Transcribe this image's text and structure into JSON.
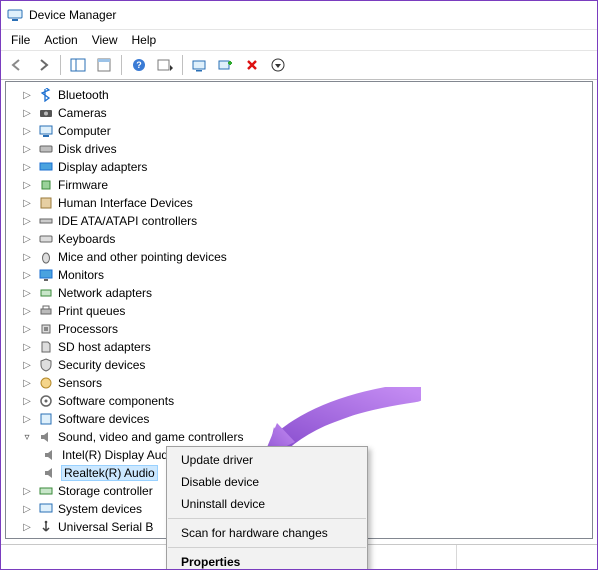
{
  "window": {
    "title": "Device Manager"
  },
  "menu": {
    "file": "File",
    "action": "Action",
    "view": "View",
    "help": "Help"
  },
  "tree": {
    "items": [
      {
        "label": "Bluetooth"
      },
      {
        "label": "Cameras"
      },
      {
        "label": "Computer"
      },
      {
        "label": "Disk drives"
      },
      {
        "label": "Display adapters"
      },
      {
        "label": "Firmware"
      },
      {
        "label": "Human Interface Devices"
      },
      {
        "label": "IDE ATA/ATAPI controllers"
      },
      {
        "label": "Keyboards"
      },
      {
        "label": "Mice and other pointing devices"
      },
      {
        "label": "Monitors"
      },
      {
        "label": "Network adapters"
      },
      {
        "label": "Print queues"
      },
      {
        "label": "Processors"
      },
      {
        "label": "SD host adapters"
      },
      {
        "label": "Security devices"
      },
      {
        "label": "Sensors"
      },
      {
        "label": "Software components"
      },
      {
        "label": "Software devices"
      }
    ],
    "expanded": {
      "label": "Sound, video and game controllers",
      "children": [
        {
          "label": "Intel(R) Display Audio"
        },
        {
          "label": "Realtek(R) Audio"
        }
      ]
    },
    "after": [
      {
        "label": "Storage controller"
      },
      {
        "label": "System devices"
      },
      {
        "label": "Universal Serial B"
      }
    ]
  },
  "context_menu": {
    "items": [
      "Update driver",
      "Disable device",
      "Uninstall device",
      "Scan for hardware changes",
      "Properties"
    ]
  }
}
